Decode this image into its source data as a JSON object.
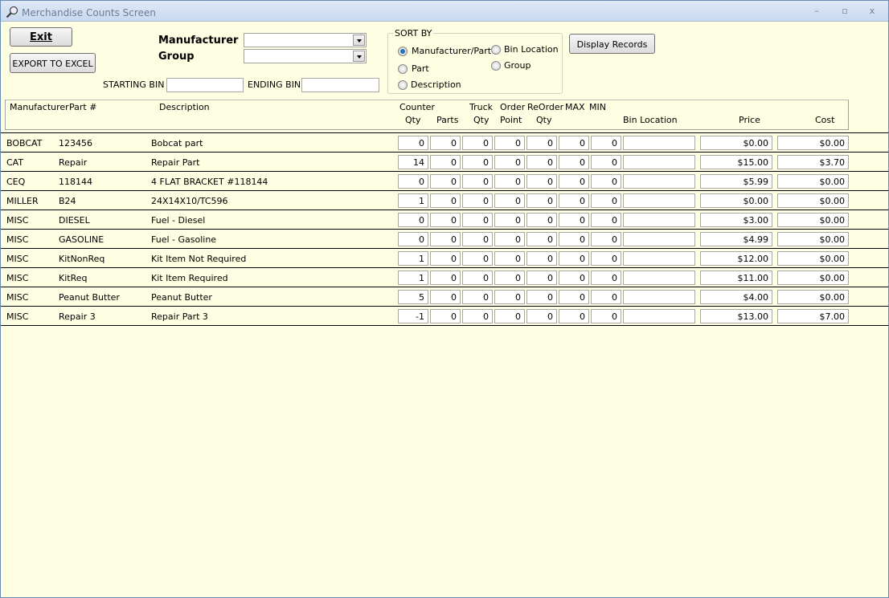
{
  "window": {
    "title": "Merchandise Counts Screen",
    "icon": "magnifier-icon",
    "minimize": "–",
    "maximize": "▫",
    "close": "x"
  },
  "toolbar": {
    "exit": "Exit",
    "export": "EXPORT TO EXCEL",
    "display": "Display Records"
  },
  "filters": {
    "manufacturer_label": "Manufacturer",
    "manufacturer_value": "",
    "group_label": "Group",
    "group_value": "",
    "starting_bin_label": "STARTING BIN",
    "starting_bin_value": "",
    "ending_bin_label": "ENDING BIN",
    "ending_bin_value": ""
  },
  "sort_by": {
    "label": "SORT BY",
    "selected": "Manufacturer/Part",
    "options": [
      "Manufacturer/Part",
      "Part",
      "Description",
      "Bin Location",
      "Group"
    ]
  },
  "columns": {
    "manufacturer": "Manufacturer",
    "part": "Part #",
    "description": "Description",
    "counter": "Counter",
    "counter2": "Qty",
    "parts": "Parts",
    "truck": "Truck",
    "truck2": "Qty",
    "order": "Order",
    "order2": "Point",
    "reorder": "ReOrder",
    "reorder2": "Qty",
    "max": "MAX",
    "min": "MIN",
    "bin": "Bin Location",
    "price": "Price",
    "cost": "Cost"
  },
  "rows": [
    {
      "mfr": "BOBCAT",
      "part": "123456",
      "desc": "Bobcat part",
      "counter": "0",
      "parts": "0",
      "truck": "0",
      "order": "0",
      "reorder": "0",
      "max": "0",
      "min": "0",
      "bin": "",
      "price": "$0.00",
      "cost": "$0.00"
    },
    {
      "mfr": "CAT",
      "part": "Repair",
      "desc": "Repair Part",
      "counter": "14",
      "parts": "0",
      "truck": "0",
      "order": "0",
      "reorder": "0",
      "max": "0",
      "min": "0",
      "bin": "",
      "price": "$15.00",
      "cost": "$3.70"
    },
    {
      "mfr": "CEQ",
      "part": "118144",
      "desc": "4 FLAT BRACKET #118144",
      "counter": "0",
      "parts": "0",
      "truck": "0",
      "order": "0",
      "reorder": "0",
      "max": "0",
      "min": "0",
      "bin": "",
      "price": "$5.99",
      "cost": "$0.00"
    },
    {
      "mfr": "MILLER",
      "part": "B24",
      "desc": "24X14X10/TC596",
      "counter": "1",
      "parts": "0",
      "truck": "0",
      "order": "0",
      "reorder": "0",
      "max": "0",
      "min": "0",
      "bin": "",
      "price": "$0.00",
      "cost": "$0.00"
    },
    {
      "mfr": "MISC",
      "part": "DIESEL",
      "desc": "Fuel - Diesel",
      "counter": "0",
      "parts": "0",
      "truck": "0",
      "order": "0",
      "reorder": "0",
      "max": "0",
      "min": "0",
      "bin": "",
      "price": "$3.00",
      "cost": "$0.00"
    },
    {
      "mfr": "MISC",
      "part": "GASOLINE",
      "desc": "Fuel - Gasoline",
      "counter": "0",
      "parts": "0",
      "truck": "0",
      "order": "0",
      "reorder": "0",
      "max": "0",
      "min": "0",
      "bin": "",
      "price": "$4.99",
      "cost": "$0.00"
    },
    {
      "mfr": "MISC",
      "part": "KitNonReq",
      "desc": "Kit Item Not Required",
      "counter": "1",
      "parts": "0",
      "truck": "0",
      "order": "0",
      "reorder": "0",
      "max": "0",
      "min": "0",
      "bin": "",
      "price": "$12.00",
      "cost": "$0.00"
    },
    {
      "mfr": "MISC",
      "part": "KitReq",
      "desc": "Kit Item Required",
      "counter": "1",
      "parts": "0",
      "truck": "0",
      "order": "0",
      "reorder": "0",
      "max": "0",
      "min": "0",
      "bin": "",
      "price": "$11.00",
      "cost": "$0.00"
    },
    {
      "mfr": "MISC",
      "part": "Peanut Butter",
      "desc": "Peanut Butter",
      "counter": "5",
      "parts": "0",
      "truck": "0",
      "order": "0",
      "reorder": "0",
      "max": "0",
      "min": "0",
      "bin": "",
      "price": "$4.00",
      "cost": "$0.00"
    },
    {
      "mfr": "MISC",
      "part": "Repair 3",
      "desc": "Repair Part 3",
      "counter": "-1",
      "parts": "0",
      "truck": "0",
      "order": "0",
      "reorder": "0",
      "max": "0",
      "min": "0",
      "bin": "",
      "price": "$13.00",
      "cost": "$7.00"
    }
  ]
}
